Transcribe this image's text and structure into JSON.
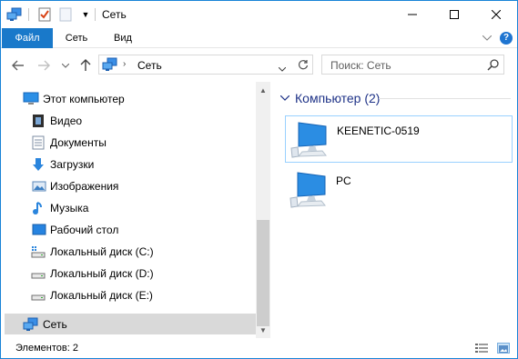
{
  "window": {
    "title": "Сеть"
  },
  "ribbon": {
    "tabs": [
      "Файл",
      "Сеть",
      "Вид"
    ]
  },
  "nav": {
    "back_icon": "back-arrow-icon",
    "forward_icon": "forward-arrow-icon",
    "recent_icon": "chevron-down-icon",
    "up_icon": "up-arrow-icon",
    "address": "Сеть",
    "search_placeholder": "Поиск: Сеть"
  },
  "sidebar": {
    "items": [
      {
        "label": "Этот компьютер",
        "icon": "computer-icon"
      },
      {
        "label": "Видео",
        "icon": "video-icon"
      },
      {
        "label": "Документы",
        "icon": "documents-icon"
      },
      {
        "label": "Загрузки",
        "icon": "downloads-icon"
      },
      {
        "label": "Изображения",
        "icon": "pictures-icon"
      },
      {
        "label": "Музыка",
        "icon": "music-icon"
      },
      {
        "label": "Рабочий стол",
        "icon": "desktop-icon"
      },
      {
        "label": "Локальный диск (C:)",
        "icon": "system-drive-icon"
      },
      {
        "label": "Локальный диск (D:)",
        "icon": "drive-icon"
      },
      {
        "label": "Локальный диск (E:)",
        "icon": "drive-icon"
      },
      {
        "label": "Сеть",
        "icon": "network-icon",
        "selected": true
      }
    ]
  },
  "content": {
    "group_title": "Компьютер (2)",
    "items": [
      {
        "name": "KEENETIC-0519",
        "icon": "network-computer-icon",
        "selected": true
      },
      {
        "name": "PC",
        "icon": "network-computer-icon",
        "selected": false
      }
    ]
  },
  "status": {
    "text": "Элементов: 2"
  },
  "colors": {
    "accent": "#1979ca",
    "selection": "#d9d9d9",
    "tile_border": "#99d1ff",
    "group_text": "#1e3287"
  }
}
